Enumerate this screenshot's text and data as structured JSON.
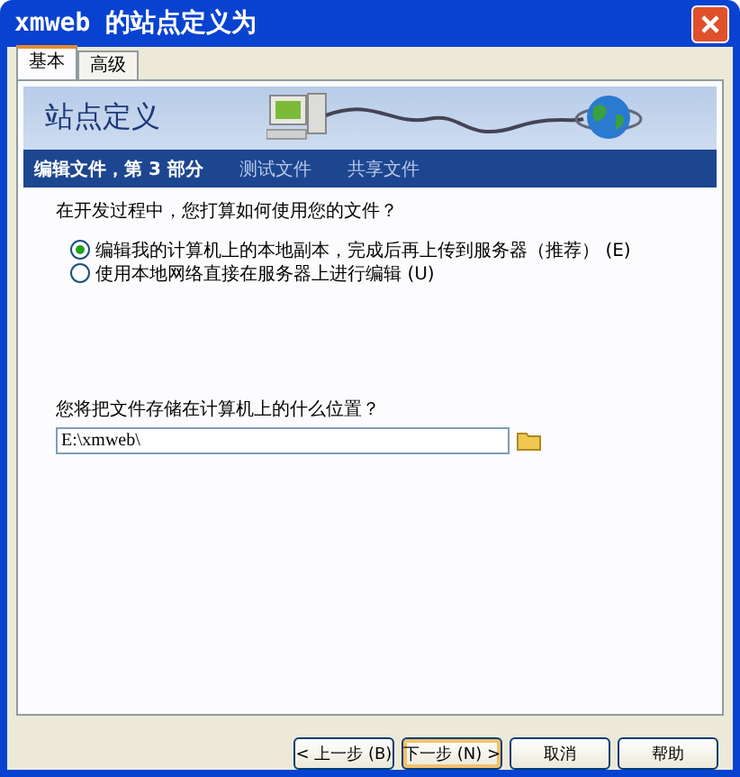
{
  "window": {
    "title": "xmweb 的站点定义为"
  },
  "tabs": [
    {
      "label": "基本",
      "selected": true
    },
    {
      "label": "高级",
      "selected": false
    }
  ],
  "banner": {
    "title": "站点定义"
  },
  "steps": [
    {
      "label": "编辑文件，第 3 部分",
      "selected": true
    },
    {
      "label": "测试文件",
      "selected": false
    },
    {
      "label": "共享文件",
      "selected": false
    }
  ],
  "question": "在开发过程中，您打算如何使用您的文件？",
  "options": [
    {
      "label": "编辑我的计算机上的本地副本，完成后再上传到服务器（推荐）",
      "key": "(E)",
      "selected": true
    },
    {
      "label": "使用本地网络直接在服务器上进行编辑",
      "key": "(U)",
      "selected": false
    }
  ],
  "location": {
    "label": "您将把文件存储在计算机上的什么位置？",
    "value": "E:\\xmweb\\"
  },
  "buttons": [
    {
      "label": "< 上一步 (B)",
      "focused": false
    },
    {
      "label": "下一步 (N) >",
      "focused": true
    },
    {
      "label": "取消",
      "focused": false
    },
    {
      "label": "帮助",
      "focused": false
    }
  ]
}
